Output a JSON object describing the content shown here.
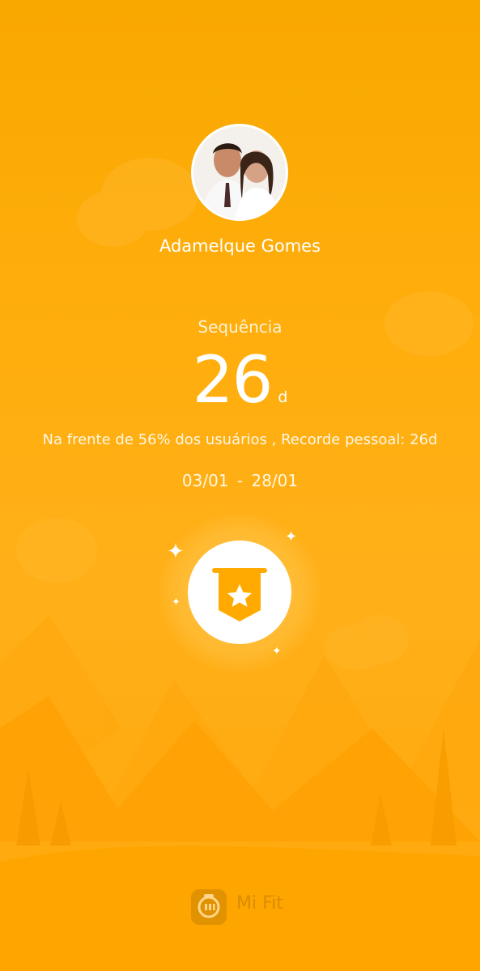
{
  "user": {
    "name": "Adamelque Gomes"
  },
  "streak": {
    "label": "Sequência",
    "value": "26",
    "unit": "d",
    "comparison": "Na frente de 56% dos usuários , Recorde pessoal: 26d",
    "date_start": "03/01",
    "date_separator": "-",
    "date_end": "28/01"
  },
  "badge": {
    "icon": "star-banner-icon"
  },
  "footer": {
    "logo_icon": "mi-logo-icon",
    "app_name": "Mi Fit"
  },
  "colors": {
    "background": "#ffae0d",
    "badge_icon": "#ffaa00",
    "text": "#ffffff"
  }
}
